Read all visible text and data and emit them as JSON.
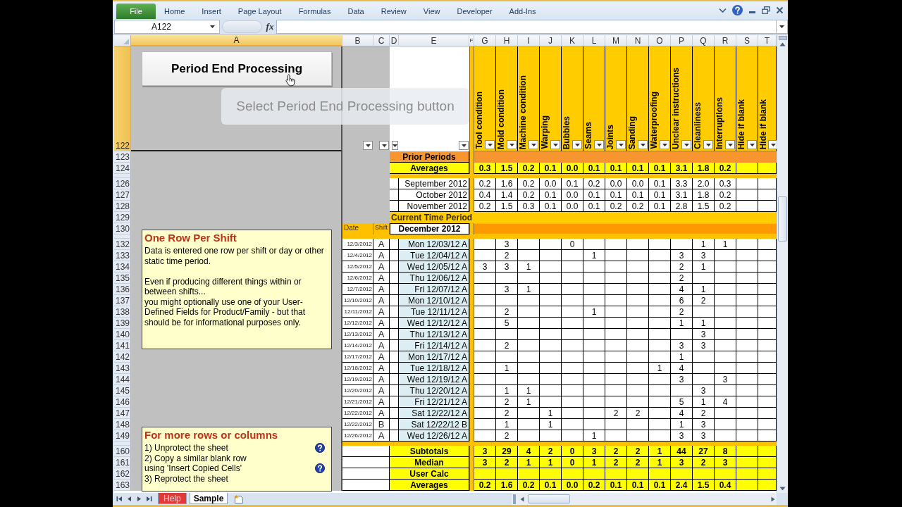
{
  "ribbon": {
    "file_tab": "File",
    "tabs": [
      {
        "label": "Home",
        "selected": false
      },
      {
        "label": "Insert",
        "selected": false
      },
      {
        "label": "Page Layout",
        "selected": false
      },
      {
        "label": "Formulas",
        "selected": false
      },
      {
        "label": "Data",
        "selected": false
      },
      {
        "label": "Review",
        "selected": false
      },
      {
        "label": "View",
        "selected": false
      },
      {
        "label": "Developer",
        "selected": false
      },
      {
        "label": "Add-Ins",
        "selected": false
      }
    ]
  },
  "formula_bar": {
    "name_box": "A122",
    "function_label": "fx"
  },
  "columns": [
    {
      "label": "A",
      "selected": true
    },
    {
      "label": "B",
      "selected": false
    },
    {
      "label": "C",
      "selected": false
    },
    {
      "label": "D",
      "selected": false
    },
    {
      "label": "E",
      "selected": false
    },
    {
      "label": "F",
      "selected": false
    },
    {
      "label": "G",
      "selected": false
    },
    {
      "label": "H",
      "selected": false
    },
    {
      "label": "I",
      "selected": false
    },
    {
      "label": "J",
      "selected": false
    },
    {
      "label": "K",
      "selected": false
    },
    {
      "label": "L",
      "selected": false
    },
    {
      "label": "M",
      "selected": false
    },
    {
      "label": "N",
      "selected": false
    },
    {
      "label": "O",
      "selected": false
    },
    {
      "label": "P",
      "selected": false
    },
    {
      "label": "Q",
      "selected": false
    },
    {
      "label": "R",
      "selected": false
    },
    {
      "label": "S",
      "selected": false
    },
    {
      "label": "T",
      "selected": false
    }
  ],
  "sheet": {
    "button": "Period End Processing",
    "callout": "Select Period End Processing button",
    "rows": [
      {
        "kind": "fields",
        "row": "122",
        "selected": true,
        "fields": [
          "Tool condition",
          "Mold condition",
          "Machine condition",
          "Warping",
          "Bubbles",
          "Seams",
          "Joints",
          "Sanding",
          "Waterproofing",
          "Unclear instructions",
          "Cleanliness",
          "Interruptions",
          "Hide if blank",
          "Hide if blank"
        ]
      },
      {
        "kind": "band",
        "row": "123",
        "selected": false,
        "label": "Prior Periods"
      },
      {
        "kind": "summary",
        "row": "124",
        "selected": false,
        "label": "Averages",
        "values": {
          "G": "0.3",
          "H": "1.5",
          "I": "0.2",
          "J": "0.1",
          "K": "0.0",
          "L": "0.1",
          "M": "0.1",
          "N": "0.1",
          "O": "0.1",
          "P": "3.1",
          "Q": "1.8",
          "R": "0.2"
        }
      },
      {
        "kind": "spacer"
      },
      {
        "kind": "month",
        "row": "126",
        "selected": false,
        "label": "September 2012",
        "values": {
          "G": "0.2",
          "H": "1.6",
          "I": "0.2",
          "J": "0.0",
          "K": "0.1",
          "L": "0.2",
          "M": "0.0",
          "N": "0.0",
          "O": "0.1",
          "P": "3.3",
          "Q": "2.0",
          "R": "0.3"
        }
      },
      {
        "kind": "month",
        "row": "127",
        "selected": false,
        "label": "October 2012",
        "values": {
          "G": "0.4",
          "H": "1.4",
          "I": "0.2",
          "J": "0.1",
          "K": "0.0",
          "L": "0.1",
          "M": "0.1",
          "N": "0.1",
          "O": "0.1",
          "P": "3.1",
          "Q": "1.8",
          "R": "0.2"
        }
      },
      {
        "kind": "month",
        "row": "128",
        "selected": false,
        "label": "November 2012",
        "values": {
          "G": "0.2",
          "H": "1.5",
          "I": "0.3",
          "J": "0.1",
          "K": "0.0",
          "L": "0.1",
          "M": "0.2",
          "N": "0.2",
          "O": "0.1",
          "P": "2.8",
          "Q": "1.5",
          "R": "0.2"
        }
      },
      {
        "kind": "section",
        "row": "129",
        "selected": false,
        "label": "Current Time Period"
      },
      {
        "kind": "period_header",
        "row": "130",
        "selected": false,
        "date_header": "Date",
        "shift_header": "Shift",
        "period": "December 2012"
      },
      {
        "kind": "spacer"
      },
      {
        "kind": "entry",
        "row": "132",
        "selected": false,
        "date": "12/3/2012",
        "shift": "A",
        "label": "Mon 12/03/12 A",
        "values": {
          "H": "3",
          "K": "0",
          "Q": "1",
          "R": "1"
        }
      },
      {
        "kind": "entry",
        "row": "133",
        "selected": false,
        "date": "12/4/2012",
        "shift": "A",
        "label": "Tue 12/04/12 A",
        "values": {
          "H": "2",
          "L": "1",
          "P": "3",
          "Q": "3"
        }
      },
      {
        "kind": "entry",
        "row": "134",
        "selected": false,
        "date": "12/5/2012",
        "shift": "A",
        "label": "Wed 12/05/12 A",
        "values": {
          "G": "3",
          "H": "3",
          "I": "1",
          "P": "2",
          "Q": "1"
        }
      },
      {
        "kind": "entry",
        "row": "135",
        "selected": false,
        "date": "12/6/2012",
        "shift": "A",
        "label": "Thu 12/06/12 A",
        "values": {
          "P": "2"
        }
      },
      {
        "kind": "entry",
        "row": "136",
        "selected": false,
        "date": "12/7/2012",
        "shift": "A",
        "label": "Fri 12/07/12 A",
        "values": {
          "H": "3",
          "I": "1",
          "P": "4",
          "Q": "1"
        }
      },
      {
        "kind": "entry",
        "row": "137",
        "selected": false,
        "date": "12/10/2012",
        "shift": "A",
        "label": "Mon 12/10/12 A",
        "values": {
          "P": "6",
          "Q": "2"
        }
      },
      {
        "kind": "entry",
        "row": "138",
        "selected": false,
        "date": "12/11/2012",
        "shift": "A",
        "label": "Tue 12/11/12 A",
        "values": {
          "H": "2",
          "L": "1",
          "P": "2"
        }
      },
      {
        "kind": "entry",
        "row": "139",
        "selected": false,
        "date": "12/12/2012",
        "shift": "A",
        "label": "Wed 12/12/12 A",
        "values": {
          "H": "5",
          "P": "1",
          "Q": "1"
        }
      },
      {
        "kind": "entry",
        "row": "140",
        "selected": false,
        "date": "12/13/2012",
        "shift": "A",
        "label": "Thu 12/13/12 A",
        "values": {
          "Q": "3"
        }
      },
      {
        "kind": "entry",
        "row": "141",
        "selected": false,
        "date": "12/14/2012",
        "shift": "A",
        "label": "Fri 12/14/12 A",
        "values": {
          "H": "2",
          "P": "3",
          "Q": "3"
        }
      },
      {
        "kind": "entry",
        "row": "142",
        "selected": false,
        "date": "12/17/2012",
        "shift": "A",
        "label": "Mon 12/17/12 A",
        "values": {
          "P": "1"
        }
      },
      {
        "kind": "entry",
        "row": "143",
        "selected": false,
        "date": "12/18/2012",
        "shift": "A",
        "label": "Tue 12/18/12 A",
        "values": {
          "H": "1",
          "O": "1",
          "P": "4"
        }
      },
      {
        "kind": "entry",
        "row": "144",
        "selected": false,
        "date": "12/19/2012",
        "shift": "A",
        "label": "Wed 12/19/12 A",
        "values": {
          "P": "3",
          "R": "3"
        }
      },
      {
        "kind": "entry",
        "row": "145",
        "selected": false,
        "date": "12/20/2012",
        "shift": "A",
        "label": "Thu 12/20/12 A",
        "values": {
          "H": "1",
          "I": "1",
          "Q": "3"
        }
      },
      {
        "kind": "entry",
        "row": "146",
        "selected": false,
        "date": "12/21/2012",
        "shift": "A",
        "label": "Fri 12/21/12 A",
        "values": {
          "H": "2",
          "I": "1",
          "P": "5",
          "Q": "1",
          "R": "4"
        }
      },
      {
        "kind": "entry",
        "row": "147",
        "selected": false,
        "date": "12/22/2012",
        "shift": "A",
        "label": "Sat 12/22/12 A",
        "values": {
          "H": "2",
          "J": "1",
          "M": "2",
          "N": "2",
          "P": "4",
          "Q": "2"
        }
      },
      {
        "kind": "entry",
        "row": "148",
        "selected": false,
        "date": "12/22/2012",
        "shift": "B",
        "label": "Sat 12/22/12 B",
        "values": {
          "H": "1",
          "J": "1",
          "P": "1",
          "Q": "3"
        }
      },
      {
        "kind": "entry",
        "row": "149",
        "selected": false,
        "date": "12/26/2012",
        "shift": "A",
        "label": "Wed 12/26/12 A",
        "values": {
          "H": "2",
          "L": "1",
          "P": "3",
          "Q": "3"
        }
      },
      {
        "kind": "spacer"
      },
      {
        "kind": "total",
        "row": "160",
        "selected": false,
        "label": "Subtotals",
        "values": {
          "G": "3",
          "H": "29",
          "I": "4",
          "J": "2",
          "K": "0",
          "L": "3",
          "M": "2",
          "N": "2",
          "O": "1",
          "P": "44",
          "Q": "27",
          "R": "8"
        }
      },
      {
        "kind": "total",
        "row": "161",
        "selected": false,
        "label": "Median",
        "values": {
          "G": "3",
          "H": "2",
          "I": "1",
          "J": "1",
          "K": "0",
          "L": "1",
          "M": "2",
          "N": "2",
          "O": "1",
          "P": "3",
          "Q": "2",
          "R": "3"
        }
      },
      {
        "kind": "total",
        "row": "162",
        "selected": false,
        "label": "User Calc"
      },
      {
        "kind": "total",
        "row": "163",
        "selected": false,
        "label": "Averages",
        "values": {
          "G": "0.2",
          "H": "1.6",
          "I": "0.2",
          "J": "0.1",
          "K": "0.0",
          "L": "0.2",
          "M": "0.1",
          "N": "0.1",
          "O": "0.1",
          "P": "2.4",
          "Q": "1.5",
          "R": "0.4"
        }
      }
    ],
    "notes": [
      {
        "title": "One Row Per Shift",
        "paragraphs": [
          [
            "Data is entered one row per shift or day or other static time period."
          ],
          [
            "Even if producing different things within or between shifts...",
            "you might optionally use one of your User-Defined Fields for Product/Family - but that should be for informational purposes only."
          ]
        ]
      },
      {
        "title": "For more rows or columns",
        "lines": [
          {
            "text": "1) Unprotect the sheet",
            "help": true
          },
          {
            "text": "2) Copy a similar blank row"
          },
          {
            "text": "using 'Insert Copied Cells'",
            "help": true
          },
          {
            "text": "3) Reprotect the sheet"
          }
        ]
      }
    ]
  },
  "sheet_tabs": [
    {
      "label": "Help",
      "selected": false,
      "color": "#e0393a"
    },
    {
      "label": "Sample",
      "selected": true
    }
  ]
}
